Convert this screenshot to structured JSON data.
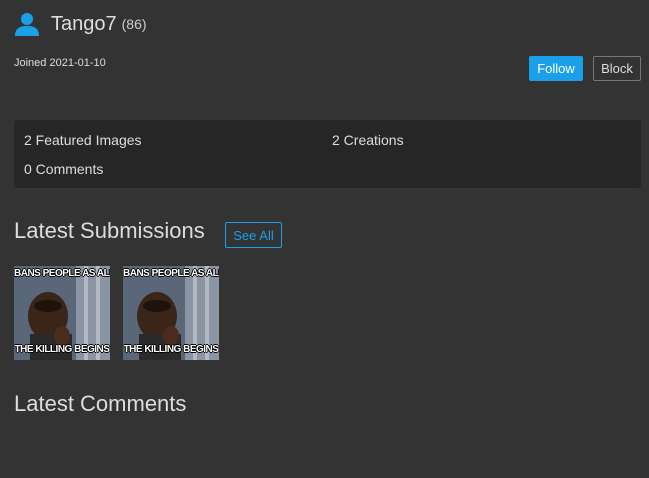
{
  "profile": {
    "username": "Tango7",
    "points": "(86)",
    "joined": "Joined 2021-01-10",
    "icon": "user-icon"
  },
  "actions": {
    "follow_label": "Follow",
    "block_label": "Block"
  },
  "stats": {
    "featured_images": "2 Featured Images",
    "creations": "2 Creations",
    "comments": "0 Comments"
  },
  "submissions": {
    "title": "Latest Submissions",
    "see_all_label": "See All",
    "items": [
      {
        "caption_top": "BANS PEOPLE AS ALL L",
        "caption_bottom": "THE KILLING BEGINS"
      },
      {
        "caption_top": "BANS PEOPLE AS ALL L",
        "caption_bottom": "THE KILLING BEGINS"
      }
    ]
  },
  "comments": {
    "title": "Latest Comments"
  },
  "colors": {
    "background": "#333333",
    "panel": "#262626",
    "accent": "#1aa0e8"
  }
}
